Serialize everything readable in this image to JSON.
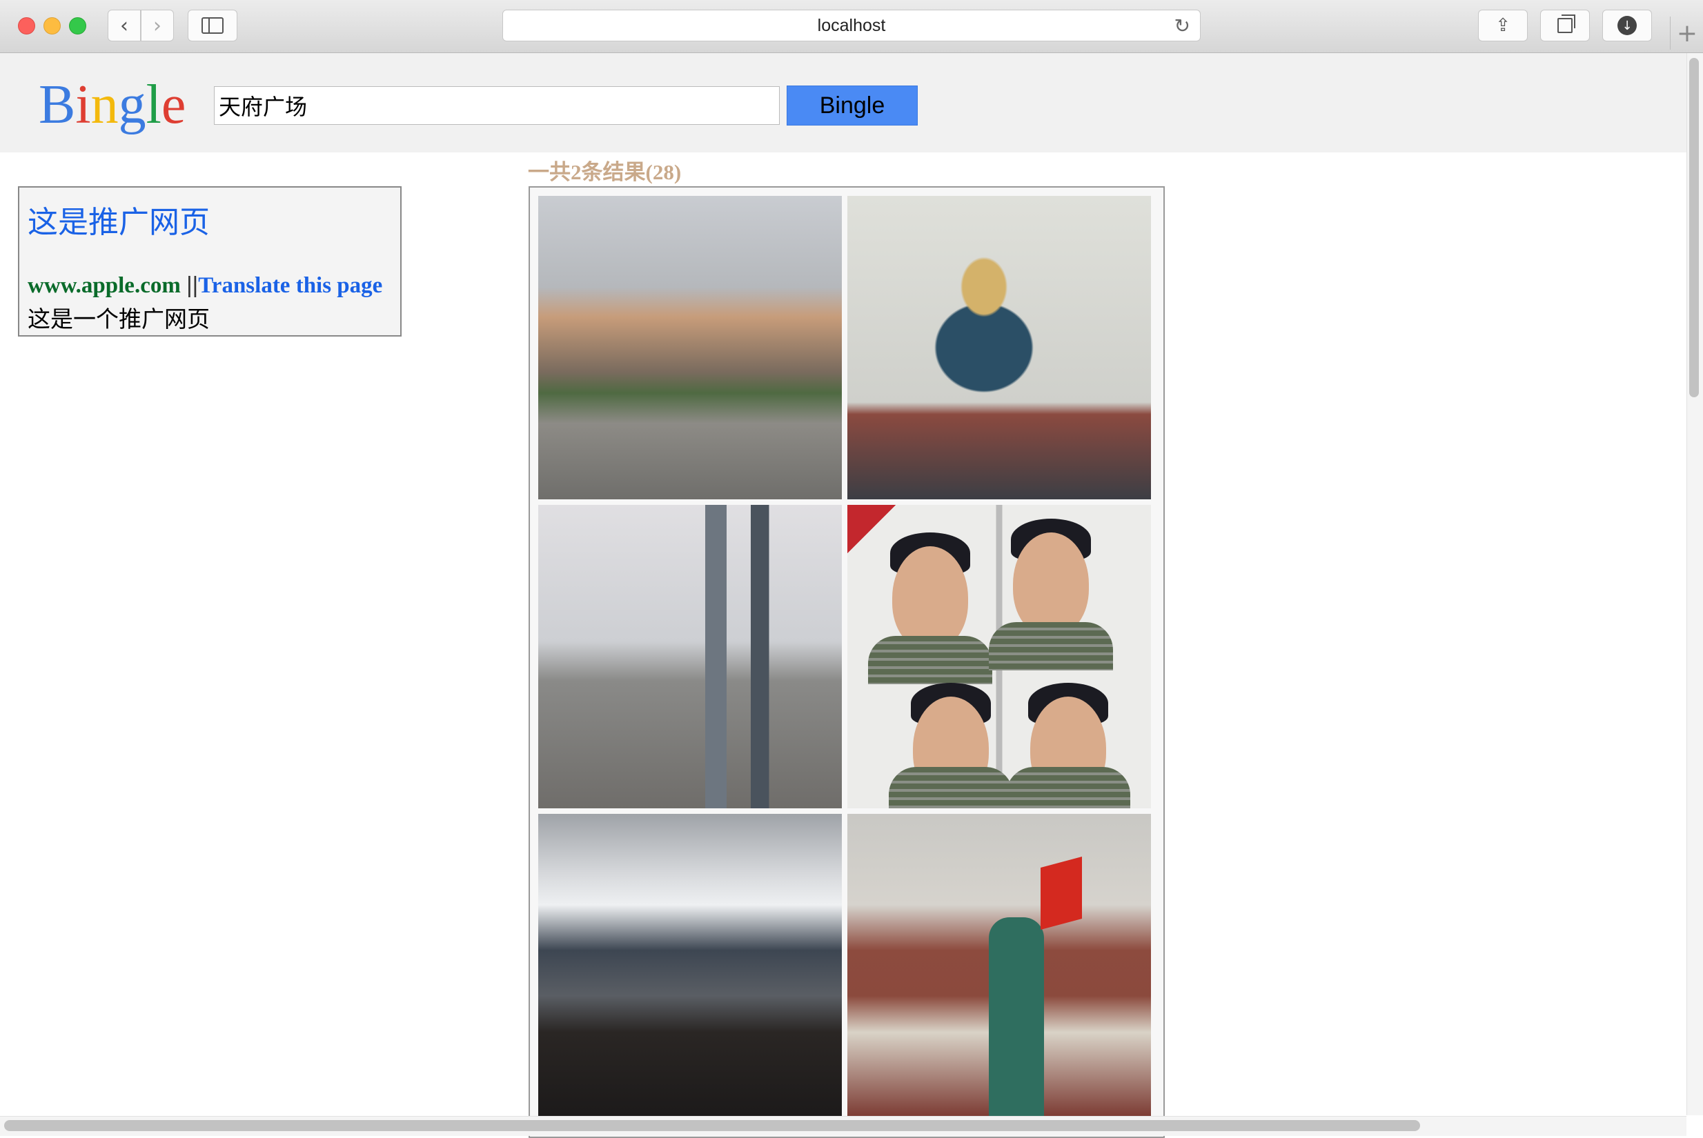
{
  "browser": {
    "url": "localhost",
    "icons": [
      "back-icon",
      "forward-icon",
      "sidebar-icon",
      "reload-icon",
      "share-icon",
      "tabs-icon",
      "download-icon",
      "new-tab-icon"
    ]
  },
  "header": {
    "logo": {
      "letters": [
        "B",
        "i",
        "n",
        "g",
        "l",
        "e"
      ],
      "colors": [
        "#3b7be0",
        "#de3e32",
        "#f3b90d",
        "#3b7be0",
        "#1f9d47",
        "#de3e32"
      ]
    },
    "search": {
      "value": "天府广场",
      "button_label": "Bingle"
    }
  },
  "ad": {
    "title": "这是推广网页",
    "url": "www.apple.com",
    "separator": "||",
    "translate_label": "Translate this page",
    "description": "这是一个推广网页"
  },
  "results": {
    "count_text": "一共2条结果(28)",
    "images": [
      {
        "description": "Tianfu Square plaza street scene"
      },
      {
        "description": "Sculpture with gold spiral"
      },
      {
        "description": "Panorama of city skyline"
      },
      {
        "description": "Grid of passport photos"
      },
      {
        "description": "Subway platform, Tianfu Square station"
      },
      {
        "description": "Sichuan Science and Technology Museum"
      }
    ]
  },
  "colors": {
    "accent_button": "#4a8af4",
    "ad_title": "#1a62e6",
    "ad_url": "#0a6b2a",
    "results_count": "#c9a98a"
  }
}
